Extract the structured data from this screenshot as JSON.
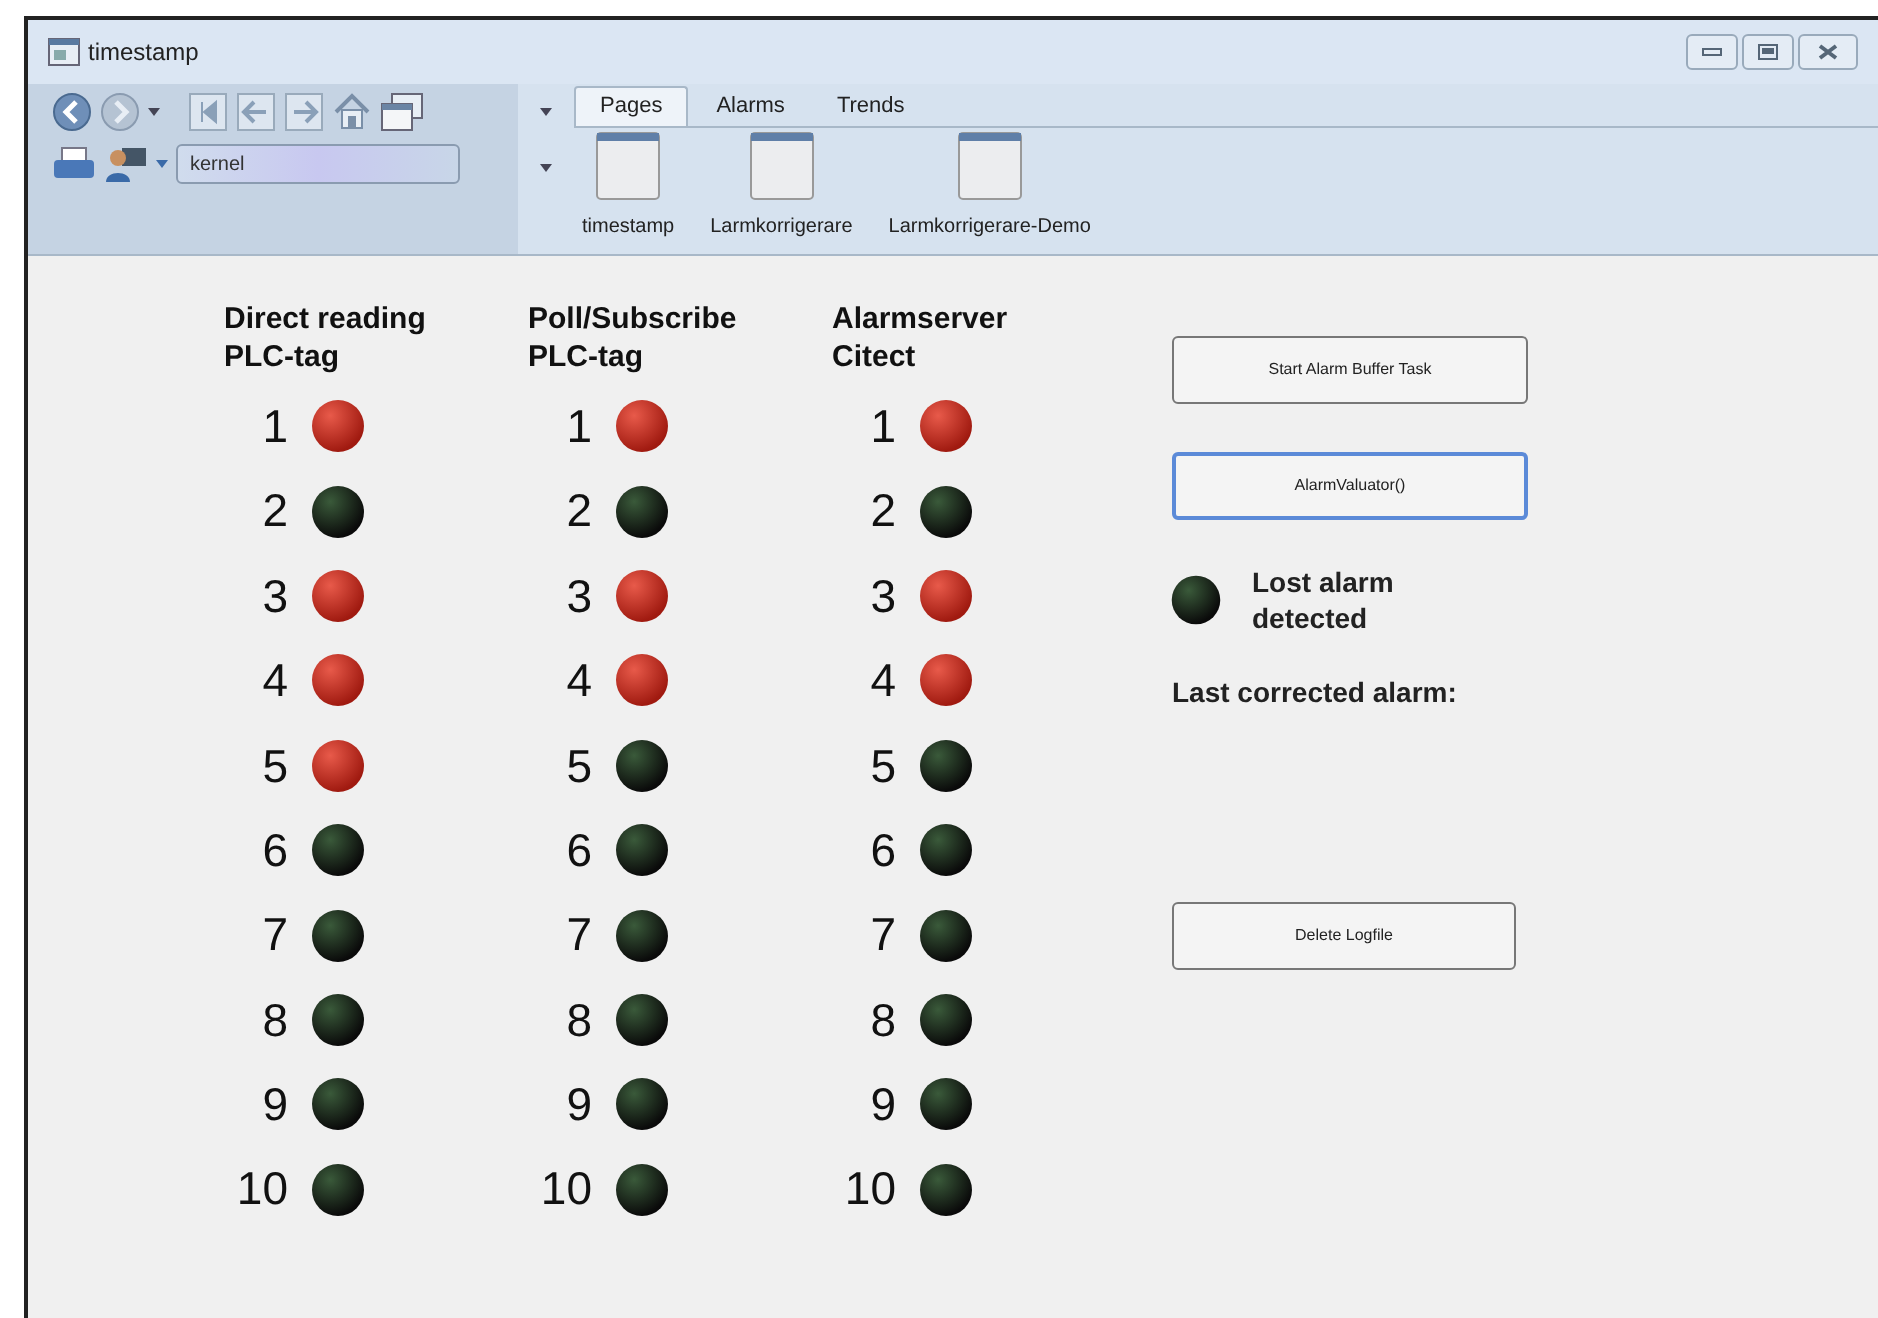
{
  "window": {
    "title": "timestamp"
  },
  "toolbar": {
    "search": {
      "value": "kernel"
    }
  },
  "tabs": [
    {
      "label": "Pages",
      "selected": true
    },
    {
      "label": "Alarms",
      "selected": false
    },
    {
      "label": "Trends",
      "selected": false
    }
  ],
  "pages": [
    {
      "label": "timestamp"
    },
    {
      "label": "Larmkorrigerare"
    },
    {
      "label": "Larmkorrigerare-Demo"
    }
  ],
  "columns": [
    {
      "title": "Direct reading PLC-tag",
      "lamps": [
        {
          "number": "1",
          "on": true
        },
        {
          "number": "2",
          "on": false
        },
        {
          "number": "3",
          "on": true
        },
        {
          "number": "4",
          "on": true
        },
        {
          "number": "5",
          "on": true
        },
        {
          "number": "6",
          "on": false
        },
        {
          "number": "7",
          "on": false
        },
        {
          "number": "8",
          "on": false
        },
        {
          "number": "9",
          "on": false
        },
        {
          "number": "10",
          "on": false
        }
      ]
    },
    {
      "title": "Poll/Subscribe PLC-tag",
      "lamps": [
        {
          "number": "1",
          "on": true
        },
        {
          "number": "2",
          "on": false
        },
        {
          "number": "3",
          "on": true
        },
        {
          "number": "4",
          "on": true
        },
        {
          "number": "5",
          "on": false
        },
        {
          "number": "6",
          "on": false
        },
        {
          "number": "7",
          "on": false
        },
        {
          "number": "8",
          "on": false
        },
        {
          "number": "9",
          "on": false
        },
        {
          "number": "10",
          "on": false
        }
      ]
    },
    {
      "title": "Alarmserver Citect",
      "lamps": [
        {
          "number": "1",
          "on": true
        },
        {
          "number": "2",
          "on": false
        },
        {
          "number": "3",
          "on": true
        },
        {
          "number": "4",
          "on": true
        },
        {
          "number": "5",
          "on": false
        },
        {
          "number": "6",
          "on": false
        },
        {
          "number": "7",
          "on": false
        },
        {
          "number": "8",
          "on": false
        },
        {
          "number": "9",
          "on": false
        },
        {
          "number": "10",
          "on": false
        }
      ]
    }
  ],
  "panel": {
    "start_button": {
      "label": "Start Alarm Buffer Task",
      "focused": false
    },
    "validator_button": {
      "label": "AlarmValuator()",
      "focused": true
    },
    "lost_alarm": {
      "label": "Lost alarm detected",
      "on": false
    },
    "last_corrected_label": "Last corrected alarm:",
    "delete_button": {
      "label": "Delete Logfile",
      "focused": false
    }
  }
}
